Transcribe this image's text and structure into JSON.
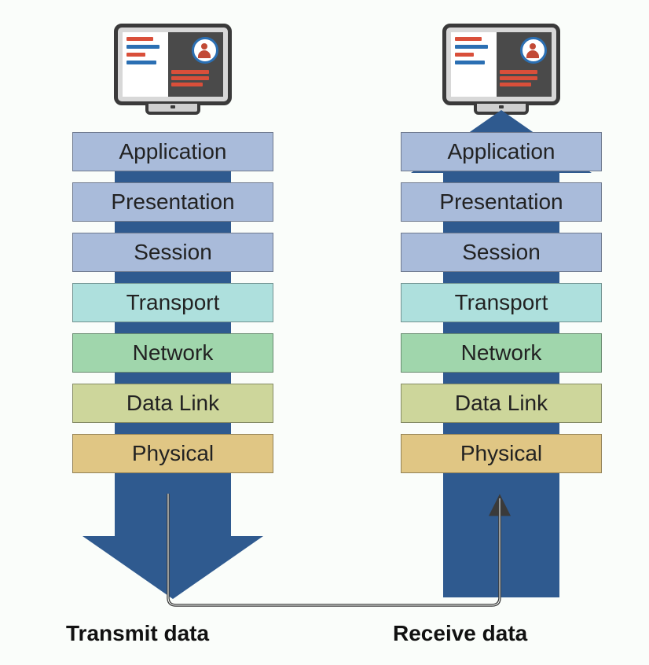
{
  "layers": [
    {
      "label": "Application",
      "cls": "c-app"
    },
    {
      "label": "Presentation",
      "cls": "c-pre"
    },
    {
      "label": "Session",
      "cls": "c-ses"
    },
    {
      "label": "Transport",
      "cls": "c-tra"
    },
    {
      "label": "Network",
      "cls": "c-net"
    },
    {
      "label": "Data Link",
      "cls": "c-dat"
    },
    {
      "label": "Physical",
      "cls": "c-phy"
    }
  ],
  "captions": {
    "transmit": "Transmit data",
    "receive": "Receive data"
  },
  "colors": {
    "arrow": "#2f5a8f",
    "palette": {
      "app": "#a9bbda",
      "transport": "#aee0dd",
      "network": "#a0d6ac",
      "datalink": "#cdd69b",
      "physical": "#e0c684"
    }
  }
}
